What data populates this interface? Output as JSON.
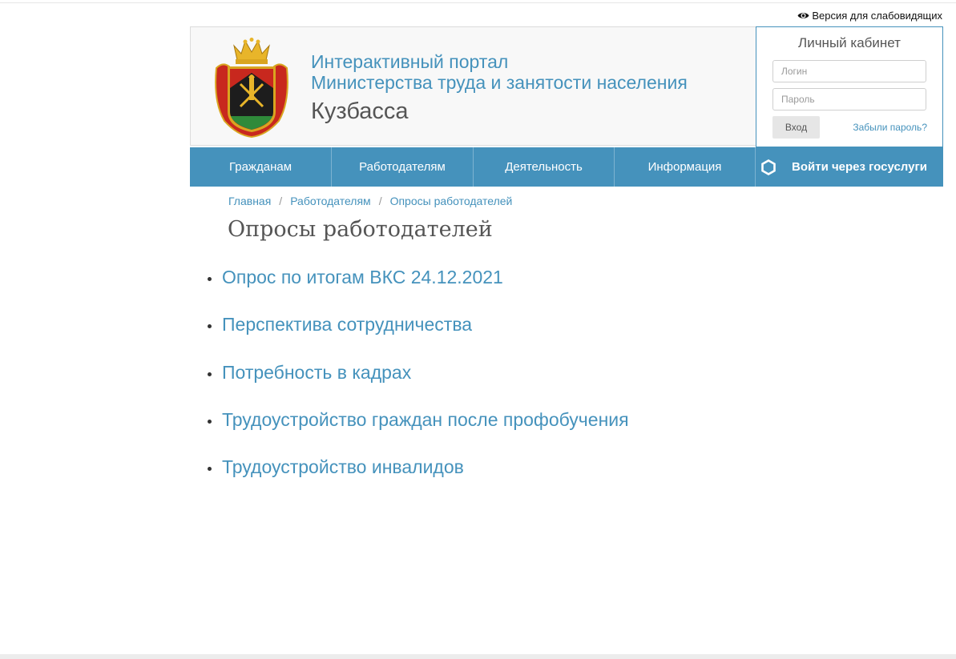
{
  "accessibility": {
    "label": "Версия для слабовидящих",
    "icon": "eye-icon"
  },
  "header": {
    "title_line1": "Интерактивный портал",
    "title_line2": "Министерства труда и занятости населения",
    "region": "Кузбасса",
    "emblem": "kuzbass-coat-of-arms"
  },
  "login": {
    "title": "Личный кабинет",
    "login_placeholder": "Логин",
    "password_placeholder": "Пароль",
    "submit_label": "Вход",
    "forgot_label": "Забыли пароль?"
  },
  "nav": {
    "items": [
      {
        "label": "Гражданам"
      },
      {
        "label": "Работодателям"
      },
      {
        "label": "Деятельность"
      },
      {
        "label": "Информация"
      }
    ],
    "gosuslugi_label": "Войти через госуслуги",
    "gosuslugi_icon": "hexagon-icon"
  },
  "breadcrumb": [
    {
      "label": "Главная"
    },
    {
      "label": "Работодателям"
    },
    {
      "label": "Опросы работодателей"
    }
  ],
  "page": {
    "title": "Опросы работодателей"
  },
  "surveys": [
    {
      "label": "Опрос по итогам ВКС 24.12.2021"
    },
    {
      "label": "Перспектива сотрудничества"
    },
    {
      "label": "Потребность в кадрах"
    },
    {
      "label": "Трудоустройство граждан после профобучения"
    },
    {
      "label": "Трудоустройство инвалидов"
    }
  ],
  "colors": {
    "accent": "#4592bc",
    "header_bg": "#f8f8f8",
    "text_dark": "#555555"
  }
}
